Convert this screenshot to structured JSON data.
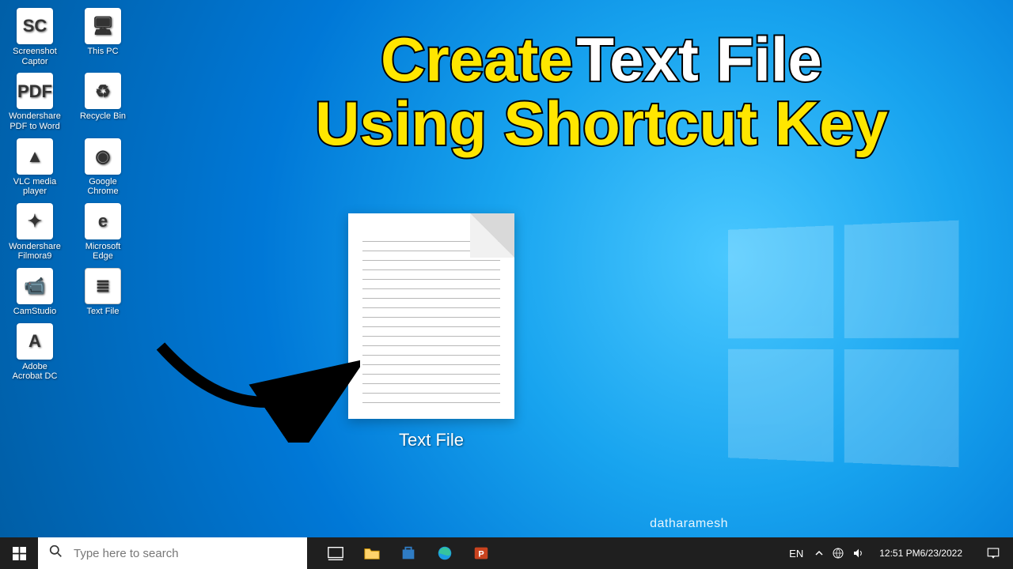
{
  "headline": {
    "w1": "Create",
    "w2": "Text File",
    "w3": "Using Shortcut Key"
  },
  "big_file_caption": "Text File",
  "watermark": "datharamesh",
  "desktop_icons": {
    "r0": [
      {
        "name": "screenshot-captor",
        "label": "Screenshot Captor",
        "glyph": "SC",
        "cls": "g-sc"
      },
      {
        "name": "this-pc",
        "label": "This PC",
        "glyph": "🖥",
        "cls": "g-pc"
      }
    ],
    "r1": [
      {
        "name": "wondershare-pdf-to-word",
        "label": "Wondershare PDF to Word",
        "glyph": "PDF",
        "cls": "g-pdf"
      },
      {
        "name": "recycle-bin",
        "label": "Recycle Bin",
        "glyph": "♻",
        "cls": "g-bin"
      }
    ],
    "r2": [
      {
        "name": "vlc",
        "label": "VLC media player",
        "glyph": "▲",
        "cls": "g-vlc"
      },
      {
        "name": "chrome",
        "label": "Google Chrome",
        "glyph": "◉",
        "cls": "g-chrome"
      }
    ],
    "r3": [
      {
        "name": "filmora9",
        "label": "Wondershare Filmora9",
        "glyph": "✦",
        "cls": "g-filmora"
      },
      {
        "name": "edge",
        "label": "Microsoft Edge",
        "glyph": "e",
        "cls": "g-edge"
      }
    ],
    "r4": [
      {
        "name": "camstudio",
        "label": "CamStudio",
        "glyph": "📹",
        "cls": "g-cam"
      },
      {
        "name": "text-file",
        "label": "Text File",
        "glyph": "≣",
        "cls": "g-txt"
      }
    ],
    "r5": [
      {
        "name": "acrobat",
        "label": "Adobe Acrobat DC",
        "glyph": "A",
        "cls": "g-acro"
      }
    ]
  },
  "taskbar": {
    "search_placeholder": "Type here to search",
    "lang": "EN",
    "time": "12:51 PM",
    "date": "6/23/2022"
  }
}
